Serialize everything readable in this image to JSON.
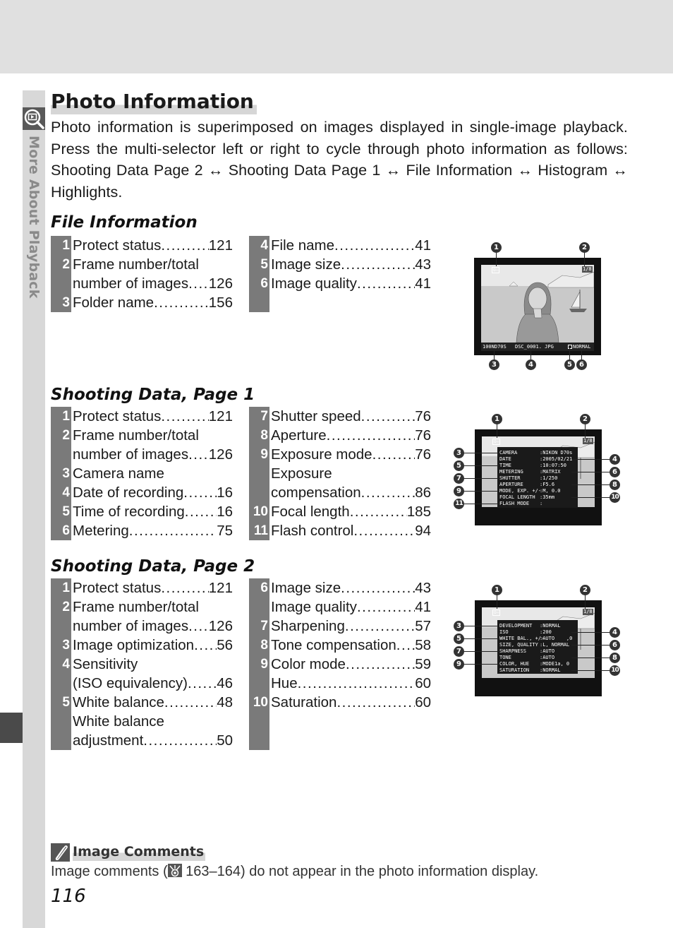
{
  "sidebar": {
    "label": "More About Playback",
    "icon": "playback-zoom-icon"
  },
  "title": "Photo Information",
  "intro": "Photo information is superimposed on images displayed in single-image playback.  Press the multi-selector left or right to cycle through photo information as follows: Shooting Data Page 2 ↔ Shooting Data Page 1 ↔ File Information ↔ Histogram ↔ Highlights.",
  "sections": [
    {
      "heading": "File Information",
      "left": [
        {
          "num": "1",
          "label": "Protect status",
          "page": "121"
        },
        {
          "num": "2",
          "label": "Frame number/total",
          "page": ""
        },
        {
          "num": "",
          "label": "number of images ",
          "page": "126"
        },
        {
          "num": "3",
          "label": "Folder name ",
          "page": "156"
        }
      ],
      "right": [
        {
          "num": "4",
          "label": "File name",
          "page": "41"
        },
        {
          "num": "5",
          "label": "Image size ",
          "page": "43"
        },
        {
          "num": "6",
          "label": "Image quality",
          "page": "41"
        },
        {
          "num": "",
          "label": "",
          "page": ""
        }
      ],
      "screen": {
        "protect": "O—",
        "frame": "1/8",
        "folder": "100ND70S",
        "file": "DSC_0001. JPG",
        "size_quality": "NORMAL",
        "callouts_top": [
          "1",
          "2"
        ],
        "callouts_bottom": [
          "3",
          "4",
          "5",
          "6"
        ]
      }
    },
    {
      "heading": "Shooting Data, Page 1",
      "left": [
        {
          "num": "1",
          "label": "Protect status",
          "page": "121"
        },
        {
          "num": "2",
          "label": "Frame number/total",
          "page": ""
        },
        {
          "num": "",
          "label": "number of images ",
          "page": "126"
        },
        {
          "num": "3",
          "label": "Camera name",
          "page": ""
        },
        {
          "num": "4",
          "label": "Date of recording",
          "page": "16"
        },
        {
          "num": "5",
          "label": "Time of recording ",
          "page": "16"
        },
        {
          "num": "6",
          "label": "Metering ",
          "page": "75"
        }
      ],
      "right": [
        {
          "num": "7",
          "label": "Shutter speed ",
          "page": "76"
        },
        {
          "num": "8",
          "label": "Aperture",
          "page": "76"
        },
        {
          "num": "9",
          "label": "Exposure mode",
          "page": "76"
        },
        {
          "num": "",
          "label": "Exposure",
          "page": ""
        },
        {
          "num": "",
          "label": "compensation",
          "page": "86"
        },
        {
          "num": "10",
          "label": "Focal length",
          "page": "185"
        },
        {
          "num": "11",
          "label": "Flash control ",
          "page": "94"
        }
      ],
      "screen": {
        "protect": "O—",
        "frame": "1/8",
        "rows": [
          {
            "key": "CAMERA",
            "value": ":NIKON D70s"
          },
          {
            "key": "DATE",
            "value": ":2005/02/21"
          },
          {
            "key": "TIME",
            "value": ":10:07:50"
          },
          {
            "key": "METERING",
            "value": ":MATRIX"
          },
          {
            "key": "SHUTTER",
            "value": ":1/250"
          },
          {
            "key": "APERTURE",
            "value": ":F5.6"
          },
          {
            "key": "MODE, EXP. +/-",
            "value": ":M, 0.0"
          },
          {
            "key": "FOCAL LENGTH",
            "value": ":35mm"
          },
          {
            "key": "FLASH MODE",
            "value": ":"
          }
        ],
        "callouts_top": [
          "1",
          "2"
        ],
        "callouts_left": [
          "3",
          "5",
          "7",
          "9",
          "11"
        ],
        "callouts_right": [
          "4",
          "6",
          "8",
          "10"
        ]
      }
    },
    {
      "heading": "Shooting Data, Page 2",
      "left": [
        {
          "num": "1",
          "label": "Protect status",
          "page": "121"
        },
        {
          "num": "2",
          "label": "Frame number/total",
          "page": ""
        },
        {
          "num": "",
          "label": "number of images ",
          "page": "126"
        },
        {
          "num": "3",
          "label": "Image optimization",
          "page": "56"
        },
        {
          "num": "4",
          "label": "Sensitivity",
          "page": ""
        },
        {
          "num": "",
          "label": "(ISO equivalency) ",
          "page": "46"
        },
        {
          "num": "5",
          "label": "White balance ",
          "page": "48"
        },
        {
          "num": "",
          "label": "White balance",
          "page": ""
        },
        {
          "num": "",
          "label": "adjustment ",
          "page": "50"
        }
      ],
      "right": [
        {
          "num": "6",
          "label": "Image size ",
          "page": "43"
        },
        {
          "num": "",
          "label": "Image quality",
          "page": "41"
        },
        {
          "num": "7",
          "label": "Sharpening ",
          "page": "57"
        },
        {
          "num": "8",
          "label": "Tone compensation",
          "page": "58"
        },
        {
          "num": "9",
          "label": "Color mode ",
          "page": "59"
        },
        {
          "num": "",
          "label": "Hue ",
          "page": "60"
        },
        {
          "num": "10",
          "label": "Saturation",
          "page": "60"
        },
        {
          "num": "",
          "label": "",
          "page": ""
        },
        {
          "num": "",
          "label": "",
          "page": ""
        }
      ],
      "screen": {
        "protect": "O—",
        "frame": "1/8",
        "rows": [
          {
            "key": "DEVELOPMENT",
            "value": ":NORMAL"
          },
          {
            "key": "ISO",
            "value": ":200"
          },
          {
            "key": "WHITE BAL., +/-",
            "value": ":AUTO    ,0"
          },
          {
            "key": "SIZE, QUALITY",
            "value": ":L, NORMAL"
          },
          {
            "key": "SHARPNESS",
            "value": ":AUTO"
          },
          {
            "key": "TONE",
            "value": ":AUTO"
          },
          {
            "key": "COLOR, HUE",
            "value": ":MODE1a, 0"
          },
          {
            "key": "SATURATION",
            "value": ":NORMAL"
          }
        ],
        "callouts_top": [
          "1",
          "2"
        ],
        "callouts_left": [
          "3",
          "5",
          "7",
          "9"
        ],
        "callouts_right": [
          "4",
          "6",
          "8",
          "10"
        ]
      }
    }
  ],
  "note": {
    "icon": "pencil-note-icon",
    "title": "Image Comments",
    "body_before": "Image comments (",
    "ref_icon": "page-reference-icon",
    "body_after": " 163–164) do not appear in the photo information display."
  },
  "page_number": "116"
}
